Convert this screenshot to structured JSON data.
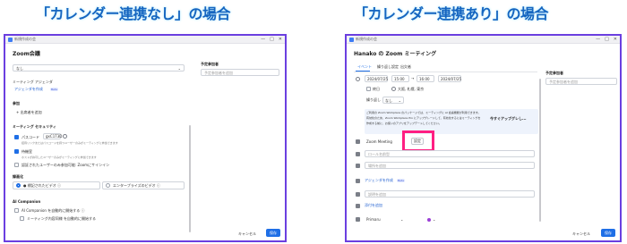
{
  "headings": {
    "left": "「カレンダー連携なし」の場合",
    "right": "「カレンダー連携あり」の場合"
  },
  "left_window": {
    "titlebar": "新規作成の会",
    "title": "Zoom会議",
    "subject_label": "",
    "subject_value": "なし",
    "meeting_tag_label": "ミーティング アジェンダ",
    "agenda_link": "アジェンダを作成",
    "beta": "Beta",
    "attendees_label": "参加",
    "add_attendee": "+ 出席者を追加",
    "security_label": "ミーティング セキュリティ",
    "passcode_label": "パスコード",
    "passcode_value": "gxC1T3D",
    "passcode_note": "招待リンクまたはパスコードを持つユーザーのみがミーティングに参加できます",
    "waiting_room": "待機室",
    "waiting_note": "ホストが許可したユーザーのみがミーティングに参加できます",
    "auth_only": "認証されたユーザーのみ参加可能: Zoomにサインイン",
    "video_label": "録画化",
    "radio1": "● 標記されたビデオ ⓘ",
    "radio2": "エンタープライズのビデオ ⓘ",
    "ai_label": "AI Companion",
    "ai_option": "AI Companion を自動的に開始する ⓘ",
    "ai_sub": "ミーティング内容同様 を自動的に開始する",
    "cancel": "キャンセル",
    "save": "保存",
    "right_panel_title": "予定参加者",
    "right_panel_placeholder": "予定参加者を追加"
  },
  "right_window": {
    "titlebar": "新規作成の会",
    "title": "Hanako の Zoom ミーティング",
    "tabs": [
      "イベント",
      "繰り返し設定",
      "出欠者"
    ],
    "date_start": "2024/07/25",
    "time_start": "15:00",
    "time_end": "16:00",
    "date_end": "2024/07/25",
    "allday": "終日",
    "timezone": "大阪, 札幌, 東京",
    "repeat_label": "繰り返し",
    "repeat_value": "なし",
    "info_text1": "ご利用の Zoom Workplace のパッケージでは、ミーティングに AI 会議機能が利用できます。",
    "info_text2": "有効化のため、Zoom Workplace Pro にアップグレードして、有効化するにはミーティングを",
    "info_text3": "作成する前に、お使いのアプリをアップデートしてください。",
    "upgrade": "今すぐアップグレし...",
    "zoom_meeting": "Zoom Meeting",
    "settings_button": "設定",
    "place_placeholder": "ロール名前型",
    "place2_placeholder": "場所を追加",
    "agenda_link": "アジェンダを作成",
    "beta": "Beta",
    "desc_placeholder": "説明を追加",
    "attach_link": "添付を追加",
    "calendar_label": "Primaru",
    "cancel": "キャンセル",
    "save": "保存",
    "right_panel_title": "予定参加者",
    "right_panel_placeholder": "予定参加者を追加"
  }
}
